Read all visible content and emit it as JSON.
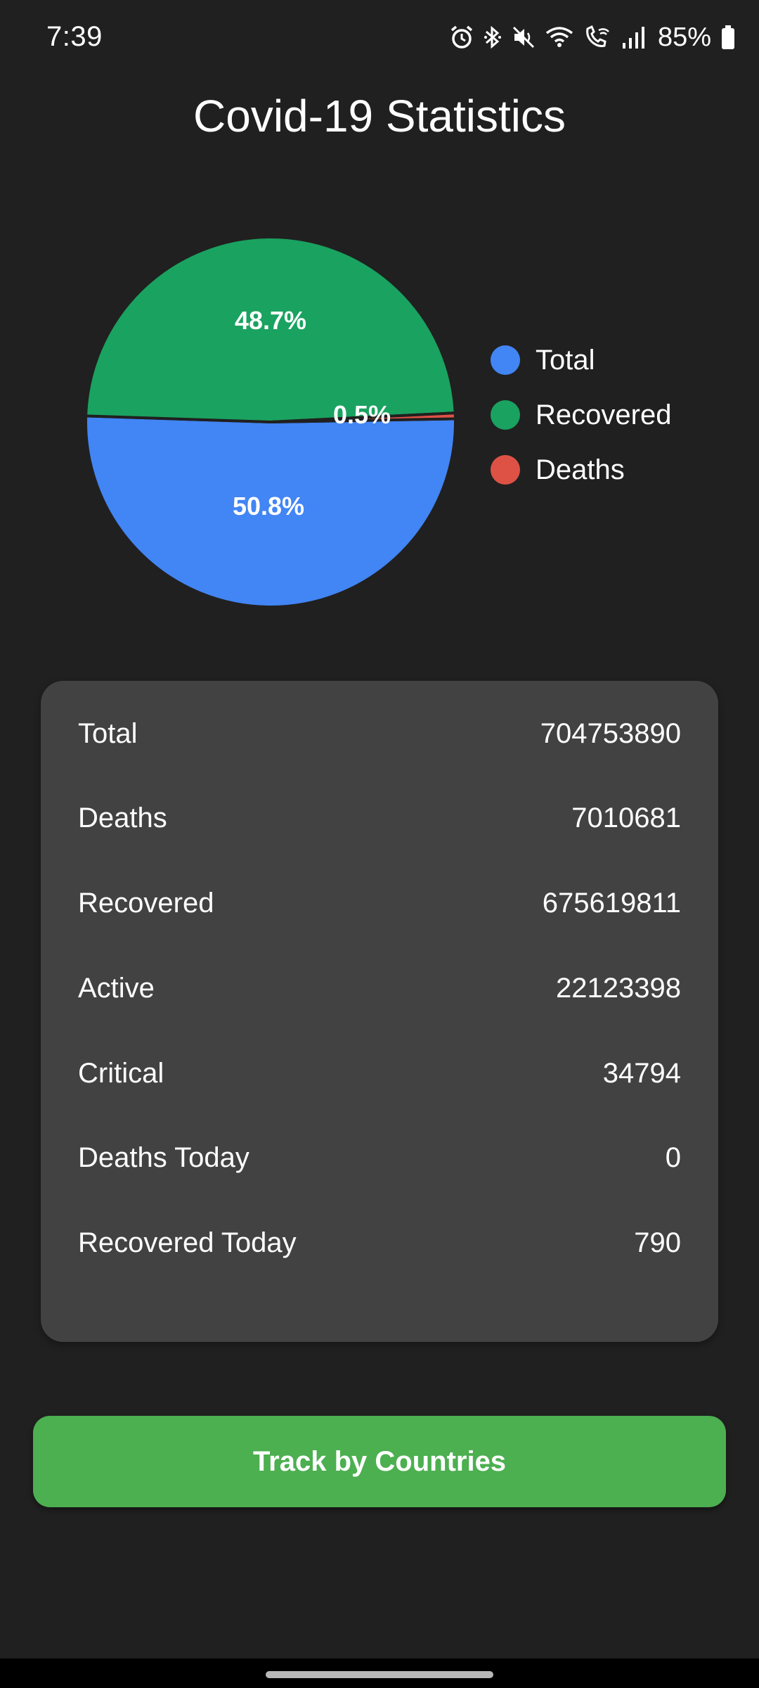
{
  "status_bar": {
    "time": "7:39",
    "battery": "85%",
    "icons": [
      "alarm-icon",
      "bluetooth-icon",
      "mute-icon",
      "wifi-icon",
      "wifi-calling-icon",
      "signal-icon",
      "battery-icon"
    ]
  },
  "header": {
    "title": "Covid-19 Statistics"
  },
  "chart_data": {
    "type": "pie",
    "slices": [
      {
        "label": "Total",
        "value": 50.8,
        "display": "50.8%",
        "color": "#4285f4"
      },
      {
        "label": "Recovered",
        "value": 48.7,
        "display": "48.7%",
        "color": "#1aa260"
      },
      {
        "label": "Deaths",
        "value": 0.5,
        "display": "0.5%",
        "color": "#de5246"
      }
    ],
    "legend_position": "right"
  },
  "stats": [
    {
      "label": "Total",
      "value": "704753890"
    },
    {
      "label": "Deaths",
      "value": "7010681"
    },
    {
      "label": "Recovered",
      "value": "675619811"
    },
    {
      "label": "Active",
      "value": "22123398"
    },
    {
      "label": "Critical",
      "value": "34794"
    },
    {
      "label": "Deaths Today",
      "value": "0"
    },
    {
      "label": "Recovered Today",
      "value": "790"
    }
  ],
  "actions": {
    "track_button_label": "Track by Countries"
  },
  "colors": {
    "background": "#202020",
    "card": "#424242",
    "button": "#4caf50"
  }
}
